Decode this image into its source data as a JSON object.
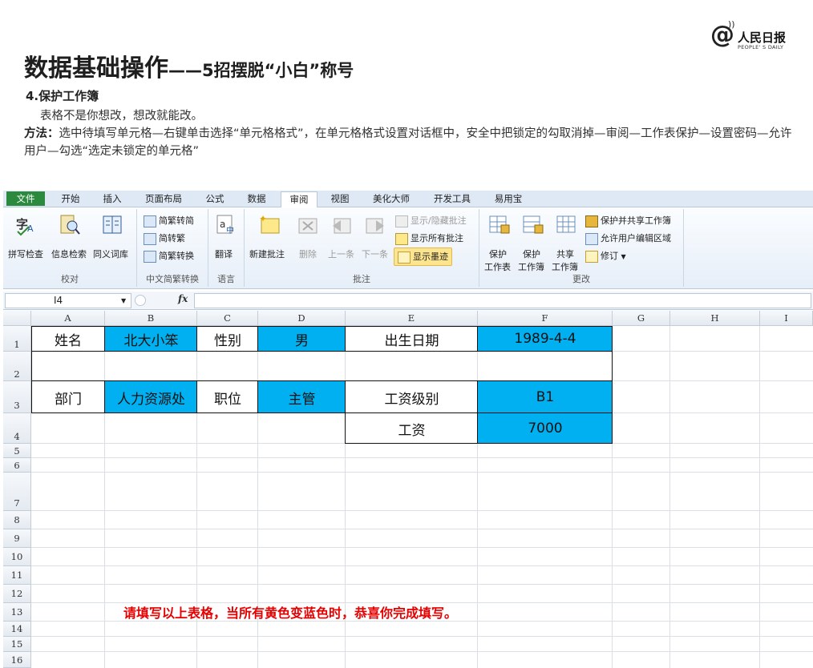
{
  "logo": {
    "cn": "人民日报",
    "en": "PEOPLE' S DAILY"
  },
  "title": {
    "main": "数据基础操作",
    "dash": "——",
    "sub": "5招摆脱“小白”称号"
  },
  "section": "4.保护工作簿",
  "desc1": "表格不是你想改，想改就能改。",
  "method_label": "方法：",
  "method_text": "选中待填写单元格—右键单击选择“单元格格式”，在单元格格式设置对话框中，安全中把锁定的勾取消掉—审阅—工作表保护—设置密码—允许用户—勾选“选定未锁定的单元格”",
  "ribbon_tabs": [
    "文件",
    "开始",
    "插入",
    "页面布局",
    "公式",
    "数据",
    "审阅",
    "视图",
    "美化大师",
    "开发工具",
    "易用宝"
  ],
  "groups": {
    "proofing": {
      "label": "校对",
      "buttons": [
        "拼写检查",
        "信息检索",
        "同义词库"
      ]
    },
    "convert": {
      "label": "中文简繁转换",
      "buttons": [
        "简繁转简",
        "简转繁",
        "简繁转换"
      ]
    },
    "language": {
      "label": "语言",
      "buttons": [
        "翻译"
      ]
    },
    "comments": {
      "label": "批注",
      "buttons": [
        "新建批注",
        "删除",
        "上一条",
        "下一条"
      ],
      "small": [
        "显示/隐藏批注",
        "显示所有批注",
        "显示墨迹"
      ]
    },
    "changes": {
      "label": "更改",
      "big": [
        [
          "保护",
          "工作表"
        ],
        [
          "保护",
          "工作簿"
        ],
        [
          "共享",
          "工作簿"
        ]
      ],
      "small": [
        "保护并共享工作簿",
        "允许用户编辑区域",
        "修订"
      ]
    }
  },
  "formula_bar": {
    "name_box": "I4",
    "fx": "fx",
    "formula": ""
  },
  "columns": [
    "A",
    "B",
    "C",
    "D",
    "E",
    "F",
    "G",
    "H",
    "I"
  ],
  "rows": [
    "1",
    "2",
    "3",
    "4",
    "5",
    "6",
    "7",
    "8",
    "9",
    "10",
    "11",
    "12",
    "13",
    "14",
    "15",
    "16"
  ],
  "table": {
    "name_label": "姓名",
    "name_value": "北大小笨",
    "gender_label": "性别",
    "gender_value": "男",
    "birth_label": "出生日期",
    "birth_value": "1989-4-4",
    "dept_label": "部门",
    "dept_value": "人力资源处",
    "pos_label": "职位",
    "pos_value": "主管",
    "grade_label": "工资级别",
    "grade_value": "B1",
    "salary_label": "工资",
    "salary_value": "7000"
  },
  "notice": "请填写以上表格，当所有黄色变蓝色时，恭喜你完成填写。",
  "colors": {
    "blue_cell": "#00b0f0",
    "notice": "#e60000",
    "file_tab": "#2b8a3e"
  }
}
